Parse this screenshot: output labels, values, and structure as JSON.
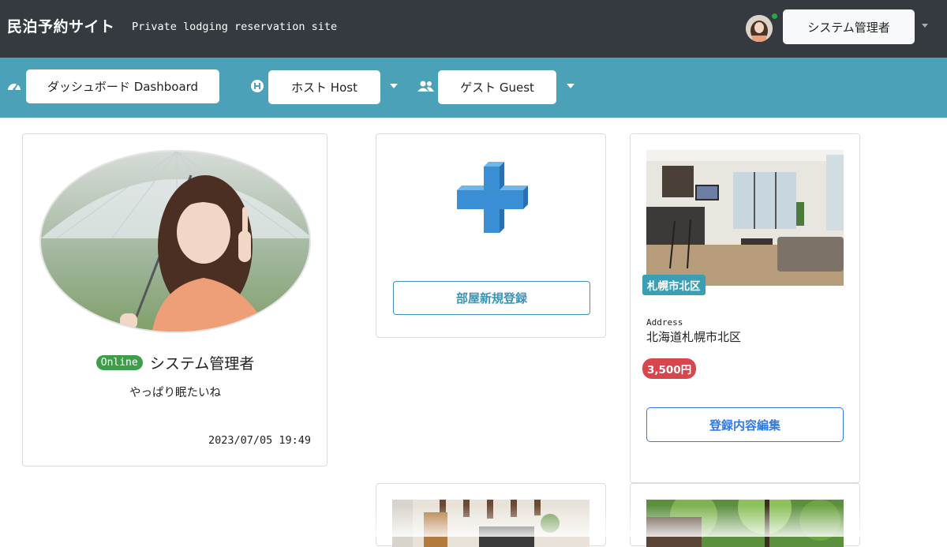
{
  "header": {
    "brand": "民泊予約サイト",
    "tagline": "Private lodging reservation site",
    "user_menu_label": "システム管理者"
  },
  "nav": {
    "dashboard_label": "ダッシュボード Dashboard",
    "host_label": "ホスト Host",
    "guest_label": "ゲスト Guest"
  },
  "profile": {
    "online_badge": "Online",
    "name": "システム管理者",
    "status_message": "やっぱり眠たいね",
    "last_updated": "2023/07/05 19:49"
  },
  "new_room": {
    "button_label": "部屋新規登録"
  },
  "room": {
    "area_badge": "札幌市北区",
    "address_label": "Address",
    "address": "北海道札幌市北区",
    "price": "3,500円",
    "edit_button_label": "登録内容編集"
  },
  "colors": {
    "topbar": "#343a40",
    "navbar": "#4aa1b8",
    "online_green": "#3e9d4a",
    "price_red": "#d9454c",
    "area_teal": "#3a9fb4",
    "outline_blue": "#2f7be3",
    "plus_blue": "#3a8fd4"
  },
  "icons": [
    "speedometer-icon",
    "host-h-icon",
    "users-icon",
    "plus-icon",
    "caret-down-icon"
  ]
}
